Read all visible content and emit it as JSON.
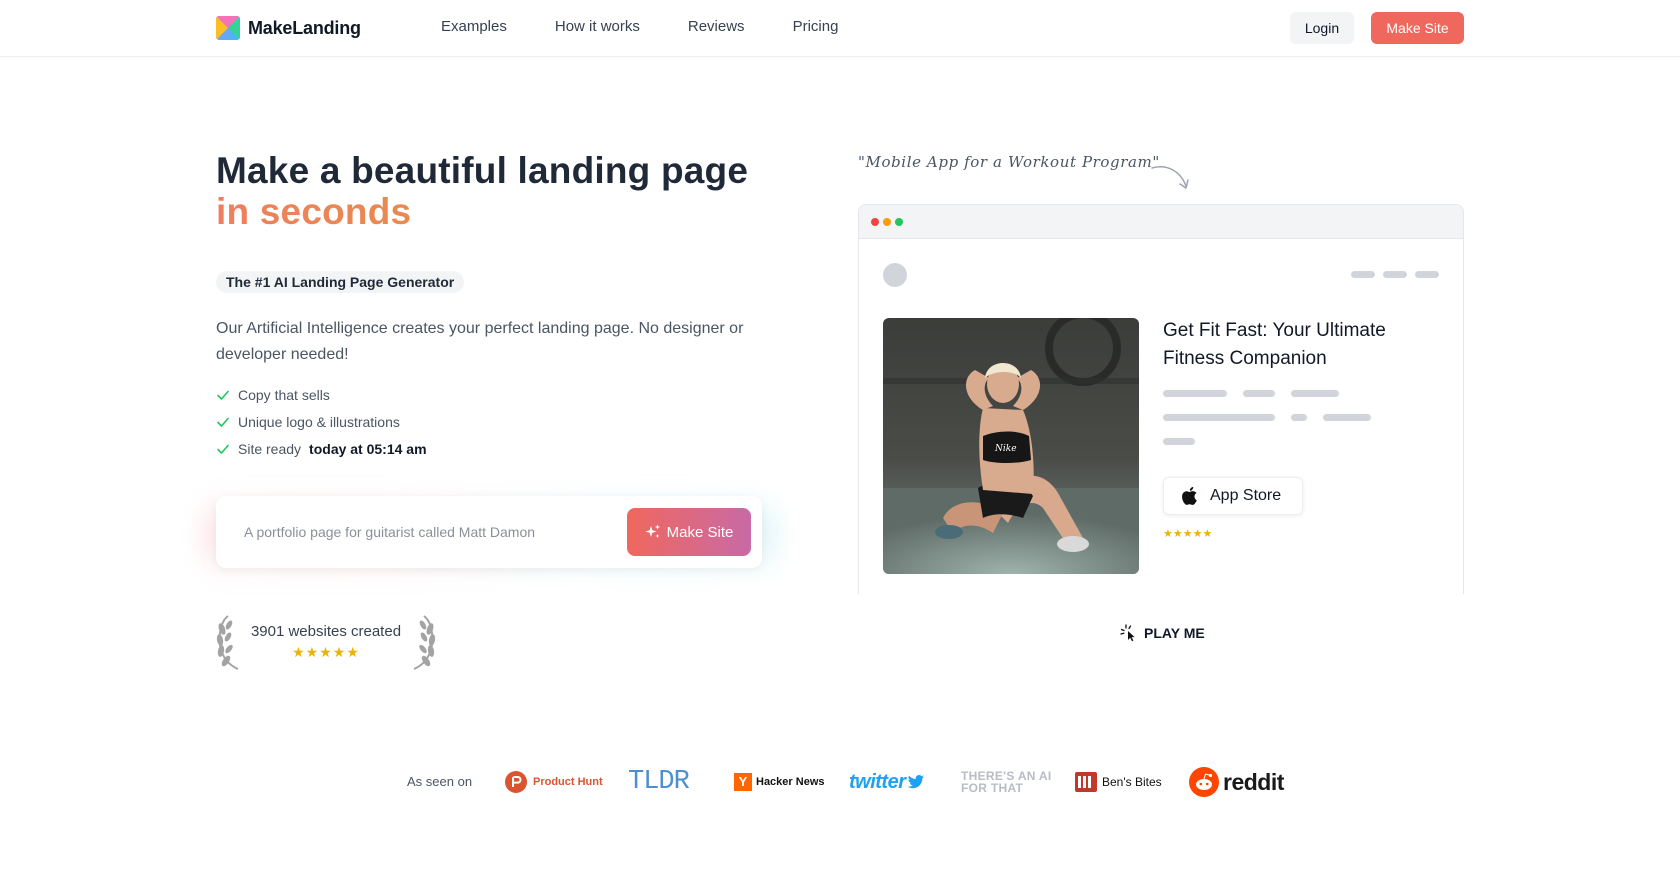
{
  "nav": {
    "brand": "MakeLanding",
    "links": [
      "Examples",
      "How it works",
      "Reviews",
      "Pricing"
    ],
    "login": "Login",
    "make_site": "Make Site"
  },
  "hero": {
    "title_line1": "Make a beautiful landing page",
    "title_line2": "in seconds",
    "badge": "The #1 AI Landing Page Generator",
    "description": "Our Artificial Intelligence creates your perfect landing page. No designer or developer needed!",
    "checks": {
      "item1": "Copy that sells",
      "item2": "Unique logo & illustrations",
      "item3_prefix": "Site ready",
      "item3_bold": "today at 05:14 am"
    },
    "prompt_placeholder": "A portfolio page for guitarist called Matt Damon",
    "prompt_button": "Make Site",
    "websites_count": "3901 websites created",
    "rating_stars": "★★★★★"
  },
  "preview": {
    "handnote": "\"Mobile App for a Workout Program\"",
    "headline": "Get Fit Fast: Your Ultimate Fitness Companion",
    "app_store": "App Store",
    "stars": "★★★★★",
    "play_me": "PLAY ME"
  },
  "as_seen_on": {
    "label": "As seen on",
    "logos": {
      "product_hunt": "Product Hunt",
      "tldr": "TLDR",
      "hacker_news": "Hacker News",
      "twitter": "twitter",
      "theres_an_ai": "THERE'S AN AI FOR THAT",
      "bens_bites": "Ben's Bites",
      "reddit": "reddit"
    }
  },
  "colors": {
    "accent": "#f0685d",
    "accent_gradient_end": "#c86aa6",
    "title_accent": "#ef8a57",
    "star": "#eab308",
    "check": "#22c55e"
  }
}
